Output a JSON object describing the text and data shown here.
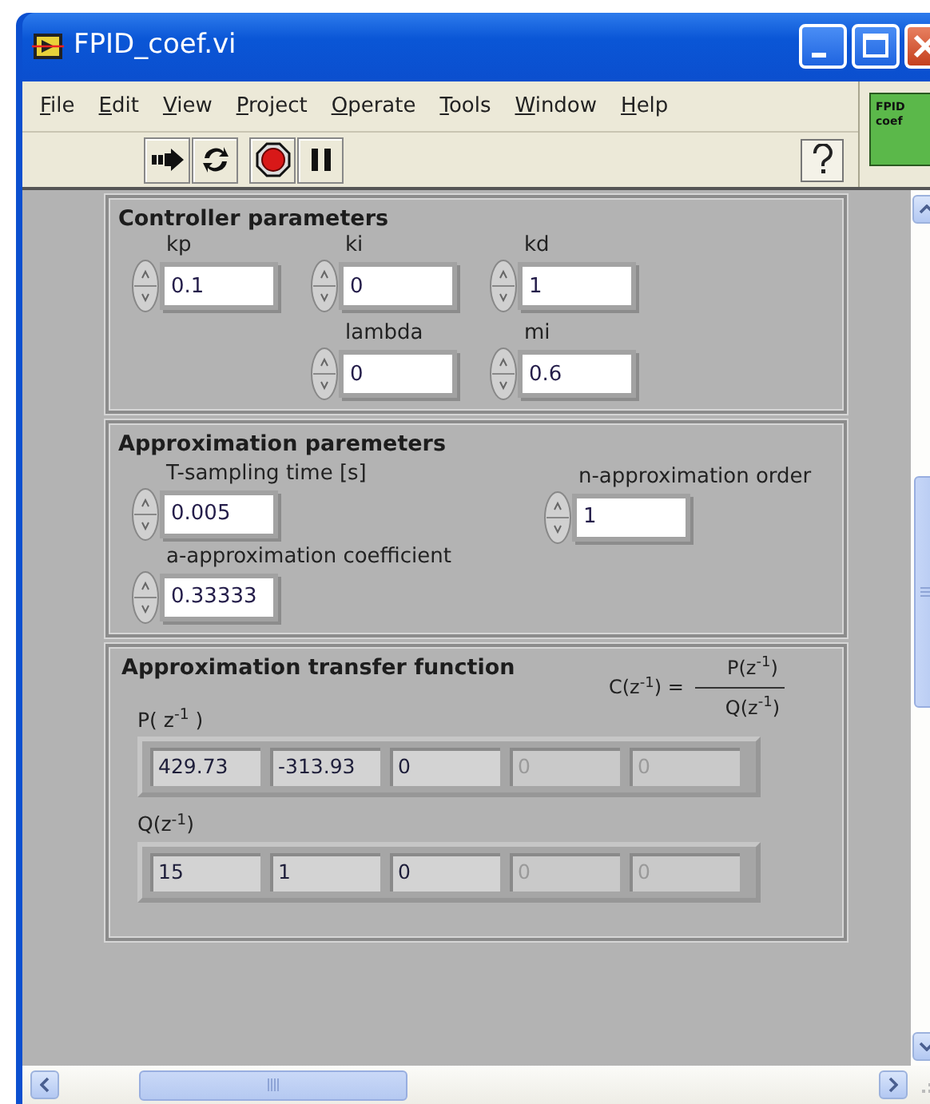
{
  "window": {
    "title": "FPID_coef.vi"
  },
  "menu": [
    "File",
    "Edit",
    "View",
    "Project",
    "Operate",
    "Tools",
    "Window",
    "Help"
  ],
  "toolbar": [
    {
      "kind": "run"
    },
    {
      "kind": "run_continuously"
    },
    {
      "kind": "abort"
    },
    {
      "kind": "pause"
    }
  ],
  "vi_icon": {
    "lines": [
      "FPID",
      "coef"
    ]
  },
  "panels": [
    {
      "title": "Controller parameters",
      "kind": "rows",
      "groups": [
        [
          {
            "label": "kp",
            "value": "0.1"
          },
          {
            "label": "ki",
            "value": "0"
          },
          {
            "label": "kd",
            "value": "1"
          }
        ],
        [
          {
            "label": "lambda",
            "value": "0"
          },
          {
            "label": "mi",
            "value": "0.6"
          }
        ]
      ]
    },
    {
      "title": "Approximation paremeters",
      "kind": "columns",
      "groups": [
        [
          {
            "label": "T-sampling time [s]",
            "value": "0.005"
          },
          {
            "label": "a-approximation coefficient",
            "value": "0.33333"
          }
        ],
        [
          {
            "label": "n-approximation order",
            "value": "1"
          }
        ]
      ]
    },
    {
      "title": "Approximation transfer function",
      "kind": "arrays",
      "formula": {
        "lhs": "C(z$^{-1}$) =",
        "numerator": "P(z$^{-1}$)",
        "denominator": "Q(z$^{-1}$)"
      },
      "arrays": [
        {
          "label": "P( z$^{-1}$ )",
          "elements": [
            {
              "value": "429.73",
              "disabled": false
            },
            {
              "value": "-313.93",
              "disabled": false
            },
            {
              "value": "0",
              "disabled": false
            },
            {
              "value": "0",
              "disabled": true
            },
            {
              "value": "0",
              "disabled": true
            }
          ]
        },
        {
          "label": "Q(z$^{-1}$)",
          "elements": [
            {
              "value": "15",
              "disabled": false
            },
            {
              "value": "1",
              "disabled": false
            },
            {
              "value": "0",
              "disabled": false
            },
            {
              "value": "0",
              "disabled": true
            },
            {
              "value": "0",
              "disabled": true
            }
          ]
        }
      ]
    }
  ]
}
